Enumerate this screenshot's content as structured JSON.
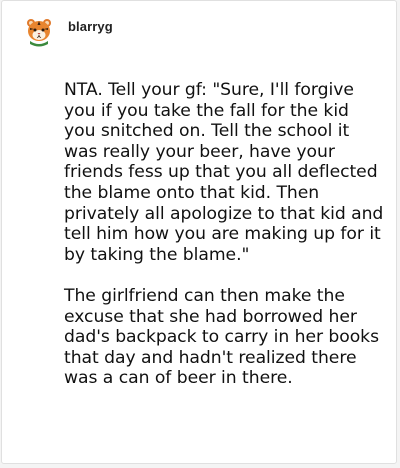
{
  "post": {
    "author": {
      "username": "blarryg",
      "avatar_icon": "tiger-avatar-icon"
    },
    "paragraphs": [
      "NTA. Tell your gf: \"Sure, I'll forgive you if you take the fall for the kid you snitched on. Tell the school it was really your beer, have your friends fess up that you all deflected the blame onto that kid. Then privately all apologize to that kid and tell him how you are making up for it by taking the blame.\"",
      "The girlfriend can then make the excuse that she had borrowed her dad's backpack to carry in her books that day and hadn't realized there was a can of beer in there."
    ]
  },
  "colors": {
    "card_background": "#ffffff",
    "page_background": "#f4f4f4",
    "text": "#111111"
  }
}
